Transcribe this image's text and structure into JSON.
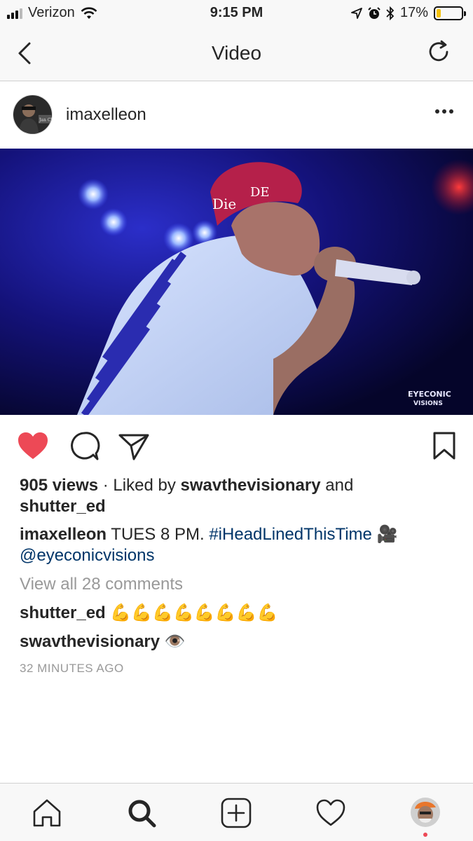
{
  "status_bar": {
    "carrier": "Verizon",
    "time": "9:15 PM",
    "battery_percent": "17%",
    "battery_level": 0.17,
    "signal_bars": 3,
    "icons": [
      "wifi-icon",
      "location-arrow-icon",
      "alarm-icon",
      "bluetooth-icon",
      "battery-icon"
    ]
  },
  "nav": {
    "title": "Video",
    "back_icon": "chevron-left-icon",
    "refresh_icon": "refresh-icon"
  },
  "post": {
    "username": "imaxelleon",
    "more_icon": "more-dots-icon",
    "video_watermark": "EYECONIC VISIONS",
    "actions": [
      "heart-filled-icon",
      "comment-icon",
      "share-icon",
      "bookmark-icon"
    ],
    "liked": true,
    "views": "905 views",
    "liked_by_prefix": " · Liked by ",
    "liked_by_user": "swavthevisionary",
    "liked_by_and": " and",
    "liked_by_user2": "shutter_ed",
    "caption": {
      "user": "imaxelleon",
      "text": " TUES 8 PM. ",
      "hashtag": "#iHeadLinedThisTime",
      "emoji": " 🎥",
      "mention": "@eyeconicvisions"
    },
    "view_all": "View all 28 comments",
    "comments": [
      {
        "user": "shutter_ed",
        "text": " 💪💪💪💪💪💪💪💪"
      },
      {
        "user": "swavthevisionary",
        "text": " 👁️"
      }
    ],
    "timestamp": "32 MINUTES AGO"
  },
  "colors": {
    "heart": "#ed4956",
    "link": "#003569",
    "muted": "#999999",
    "text": "#262626"
  },
  "tabbar": {
    "tabs": [
      "home-icon",
      "search-icon",
      "new-post-icon",
      "activity-heart-icon",
      "profile-avatar"
    ]
  }
}
